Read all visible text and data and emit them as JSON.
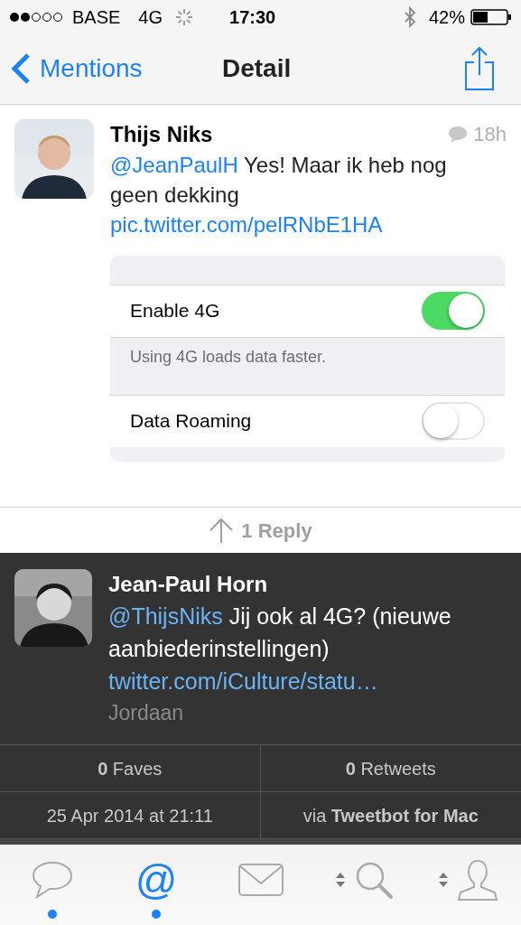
{
  "status_bar": {
    "carrier": "BASE",
    "network": "4G",
    "time": "17:30",
    "battery": "42%"
  },
  "nav": {
    "back": "Mentions",
    "title": "Detail"
  },
  "tweet": {
    "name": "Thijs Niks",
    "time": "18h",
    "text": [
      {
        "kind": "mention",
        "text": "@JeanPaulH"
      },
      {
        "kind": "text",
        "text": " Yes! Maar ik heb nog geen dekking "
      },
      {
        "kind": "link",
        "text": "pic.twitter.com/pelRNbE1HA"
      }
    ],
    "attachment": {
      "rows": [
        {
          "kind": "gap"
        },
        {
          "kind": "toggle",
          "label": "Enable 4G",
          "on": true
        },
        {
          "kind": "footer",
          "text": "Using 4G loads data faster."
        },
        {
          "kind": "toggle",
          "label": "Data Roaming",
          "on": false
        },
        {
          "kind": "gap"
        }
      ]
    }
  },
  "replies": {
    "label": "1 Reply"
  },
  "reply": {
    "name": "Jean-Paul Horn",
    "text": [
      {
        "kind": "mention",
        "text": "@ThijsNiks"
      },
      {
        "kind": "text",
        "text": " Jij ook al 4G? (nieuwe aanbiederinstellingen) "
      },
      {
        "kind": "link",
        "text": "twitter.com/iCulture/statu…"
      }
    ],
    "location": "Jordaan",
    "stats": [
      {
        "text": "**0** Faves"
      },
      {
        "text": "**0** Retweets"
      },
      {
        "text": "25 Apr 2014 at 21:11"
      },
      {
        "text": "via **Tweetbot for Mac**"
      }
    ]
  },
  "tab_bar": [
    {
      "kind": "chat",
      "selected": false,
      "unread": true,
      "switch": false
    },
    {
      "kind": "at",
      "glyph": "@",
      "selected": true,
      "unread": true,
      "switch": false
    },
    {
      "kind": "mail",
      "selected": false,
      "unread": false,
      "switch": false
    },
    {
      "kind": "search",
      "selected": false,
      "unread": false,
      "switch": true
    },
    {
      "kind": "person",
      "selected": false,
      "unread": false,
      "switch": true
    }
  ]
}
